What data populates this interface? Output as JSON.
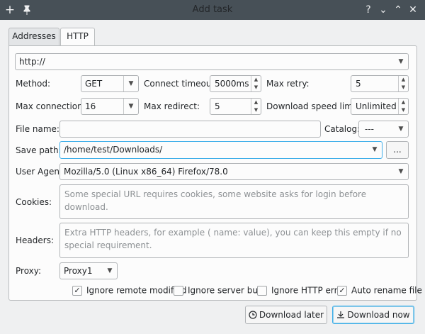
{
  "window": {
    "title": "Add task",
    "controls": [
      "?",
      "⌄",
      "⌃",
      "✕"
    ]
  },
  "tabs": {
    "addresses": "Addresses",
    "http": "HTTP"
  },
  "url": {
    "value": "http://"
  },
  "method": {
    "label": "Method:",
    "value": "GET"
  },
  "connect_timeout": {
    "label": "Connect timeout:",
    "value": "5000ms"
  },
  "max_retry": {
    "label": "Max retry:",
    "value": "5"
  },
  "max_connections": {
    "label": "Max connections:",
    "value": "16"
  },
  "max_redirect": {
    "label": "Max redirect:",
    "value": "5"
  },
  "speed_limit": {
    "label": "Download speed limit:",
    "value": "Unlimited"
  },
  "file_name": {
    "label": "File name:",
    "value": ""
  },
  "catalog": {
    "label": "Catalog:",
    "value": "---"
  },
  "save_path": {
    "label": "Save path:",
    "value": "/home/test/Downloads/",
    "browse": "..."
  },
  "user_agent": {
    "label": "User Agent:",
    "value": "Mozilla/5.0 (Linux x86_64) Firefox/78.0"
  },
  "cookies": {
    "label": "Cookies:",
    "placeholder": "Some special URL requires cookies, some website asks for login before download."
  },
  "headers": {
    "label": "Headers:",
    "placeholder": "Extra HTTP headers, for example ( name: value), you can keep this empty if no special requirement."
  },
  "proxy": {
    "label": "Proxy:",
    "value": "Proxy1"
  },
  "options": [
    {
      "label": "Ignore remote modified",
      "checked": true
    },
    {
      "label": "Ignore server busy",
      "checked": false
    },
    {
      "label": "Ignore HTTP error",
      "checked": false
    },
    {
      "label": "Auto rename file",
      "checked": true
    }
  ],
  "buttons": {
    "download_later": "Download later",
    "download_now": "Download now"
  },
  "colors": {
    "titlebar": "#475057",
    "window_bg": "#eff0f1",
    "focus": "#3daee9"
  },
  "icons": [
    "plus-icon",
    "pin-icon",
    "help-icon",
    "chevron-down-icon",
    "chevron-up-icon",
    "close-icon",
    "clock-icon",
    "download-icon"
  ]
}
